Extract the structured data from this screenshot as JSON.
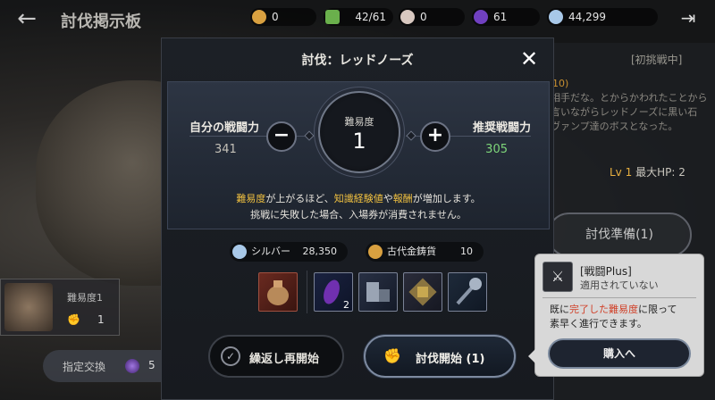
{
  "topbar": {
    "back_icon": "←",
    "title": "討伐掲示板",
    "currencies": [
      {
        "icon": "gold-coin-icon",
        "color": "#d8a040",
        "value": "0"
      },
      {
        "icon": "green-gem-icon",
        "color": "#6ab04c",
        "value": "42/61"
      },
      {
        "icon": "pearl-icon",
        "color": "#d8c8c0",
        "value": "0"
      },
      {
        "icon": "purple-orb-icon",
        "color": "#7040c0",
        "value": "61"
      },
      {
        "icon": "silver-coin-icon",
        "color": "#a8c8e8",
        "value": "44,299"
      }
    ],
    "exit_icon": "⇥"
  },
  "background": {
    "tag": "[初挑戦中]",
    "desc_lines": [
      "10)",
      "相手だな。とからかわれたことから",
      "言いながらレッドノーズに黒い石",
      "ヴァンプ達のボスとなった。"
    ],
    "level_prefix": "Lv",
    "level_num": "1",
    "level_rest": "最大HP: 2",
    "prep_button": "討伐準備(1)",
    "card_label": "難易度1",
    "card_num": "1",
    "exchange_label": "指定交換",
    "exchange_num": "5"
  },
  "dialog": {
    "title": "討伐：レッドノーズ",
    "close_icon": "✕",
    "own_power_label": "自分の戦闘力",
    "own_power_value": "341",
    "rec_power_label": "推奨戦闘力",
    "rec_power_value": "305",
    "minus": "−",
    "plus": "+",
    "difficulty_label": "難易度",
    "difficulty_value": "1",
    "note1_parts": [
      "難易度",
      "が上がるほど、",
      "知識経験値",
      "や",
      "報酬",
      "が増加します。"
    ],
    "note2": "挑戦に失敗した場合、入場券が消費されません。",
    "rewards": [
      {
        "icon": "silver-coin-icon",
        "color": "#a8c8e8",
        "label": "シルバー",
        "value": "28,350"
      },
      {
        "icon": "ancient-gold-coin-icon",
        "color": "#d8a040",
        "label": "古代金鋳貨",
        "value": "10"
      }
    ],
    "items": [
      {
        "name": "bag-item",
        "count": ""
      },
      {
        "name": "purple-gem-item",
        "count": "2"
      },
      {
        "name": "stone-block-item",
        "count": ""
      },
      {
        "name": "gold-box-item",
        "count": ""
      },
      {
        "name": "mace-item",
        "count": ""
      }
    ],
    "repeat_button": "繰返し再開始",
    "start_button": "討伐開始 (1)"
  },
  "tooltip": {
    "name": "[戦闘Plus]",
    "status": "適用されていない",
    "desc_parts": [
      "既に",
      "完了した難易度",
      "に限って",
      "素早く進行できます。"
    ],
    "buy_button": "購入へ"
  }
}
